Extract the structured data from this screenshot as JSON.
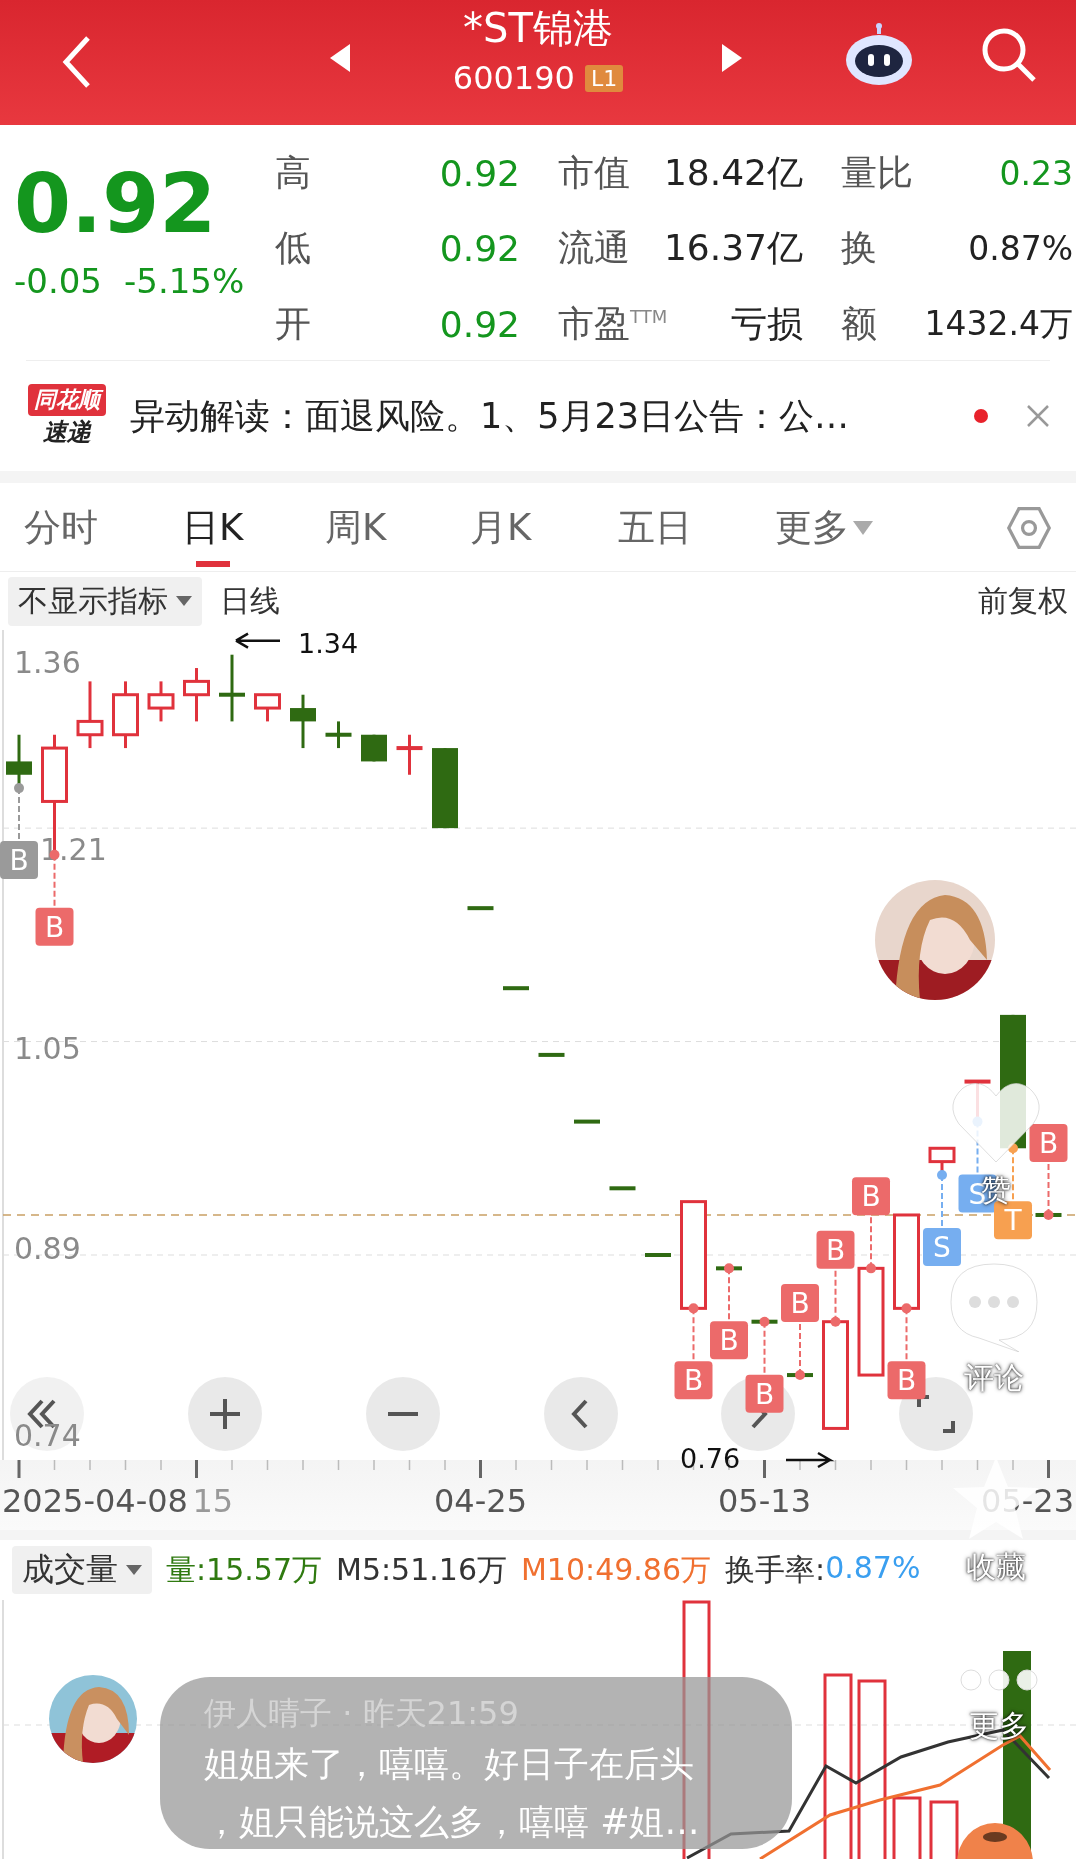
{
  "header": {
    "title": "*ST锦港",
    "code": "600190",
    "badge": "L1"
  },
  "quote": {
    "price": "0.92",
    "change": "-0.05",
    "change_pct": "-5.15%",
    "color": "#14961e",
    "rows": [
      {
        "cells": [
          {
            "label": "高",
            "value": "0.92",
            "color": "#14961e"
          },
          {
            "label": "市值",
            "value": "18.42亿",
            "color": "#222222"
          },
          {
            "label": "量比",
            "value": "0.23",
            "color": "#14961e"
          }
        ]
      },
      {
        "cells": [
          {
            "label": "低",
            "value": "0.92",
            "color": "#14961e"
          },
          {
            "label": "流通",
            "value": "16.37亿",
            "color": "#222222"
          },
          {
            "label": "换",
            "value": "0.87%",
            "color": "#222222"
          }
        ]
      },
      {
        "cells": [
          {
            "label": "开",
            "value": "0.92",
            "color": "#14961e"
          },
          {
            "label": "市盈$^{TTM}$",
            "value": "亏损",
            "color": "#222222"
          },
          {
            "label": "额",
            "value": "1432.4万",
            "color": "#222222"
          }
        ]
      }
    ]
  },
  "news": {
    "logo_top": "同花顺",
    "logo_bottom": "速递",
    "text": "异动解读：面退风险。1、5月23日公告：公…",
    "unread": true
  },
  "tabs": [
    {
      "label": "分时",
      "selected": false
    },
    {
      "label": "日K",
      "selected": true
    },
    {
      "label": "周K",
      "selected": false
    },
    {
      "label": "月K",
      "selected": false
    },
    {
      "label": "五日",
      "selected": false
    },
    {
      "label": "更多",
      "selected": false,
      "dropdown": true
    }
  ],
  "indicator_bar": {
    "indicator": "不显示指标",
    "period": "日线",
    "adjust": "前复权"
  },
  "kline": {
    "price_labels": [
      "1.36",
      "1.21",
      "1.05",
      "0.89",
      "0.74"
    ],
    "date_labels": [
      "2025-04-08",
      "15",
      "04-25",
      "05-13",
      "05-23"
    ],
    "high_label": "1.34",
    "low_label": "0.76",
    "markers": [
      {
        "text": "B",
        "color": "#9a9a9a"
      },
      {
        "text": "B",
        "color": "#ec6a6a"
      },
      {
        "text": "B",
        "color": "#ec6a6a"
      },
      {
        "text": "B",
        "color": "#ec6a6a"
      },
      {
        "text": "B",
        "color": "#ec6a6a"
      },
      {
        "text": "B",
        "color": "#ec6a6a"
      },
      {
        "text": "B",
        "color": "#ec6a6a"
      },
      {
        "text": "B",
        "color": "#ec6a6a"
      },
      {
        "text": "B",
        "color": "#ec6a6a"
      },
      {
        "text": "S",
        "color": "#76aef0"
      },
      {
        "text": "S",
        "color": "#76aef0"
      },
      {
        "text": "T",
        "color": "#f7a050"
      },
      {
        "text": "B",
        "color": "#ec6a6a"
      }
    ]
  },
  "volume": {
    "selector": "成交量",
    "stats": [
      {
        "text": "量:15.57万",
        "color": "#2f7a10"
      },
      {
        "text": "M5:51.16万",
        "color": "#333333"
      },
      {
        "text": "M10:49.86万",
        "color": "#f07030"
      },
      {
        "text": "换手率:",
        "color": "#333333"
      },
      {
        "text": "0.87%",
        "color": "#3a9ff0"
      }
    ]
  },
  "side_actions": [
    {
      "kind": "like",
      "label": "赞"
    },
    {
      "kind": "comment",
      "label": "评论"
    },
    {
      "kind": "favorite",
      "label": "收藏"
    },
    {
      "kind": "more",
      "label": "更多"
    }
  ],
  "comment": {
    "meta": "伊人晴子 · 昨天21:59",
    "text": "姐姐来了，嘻嘻。好日子在后头，姐只能说这么多，嘻嘻 #姐…"
  }
}
